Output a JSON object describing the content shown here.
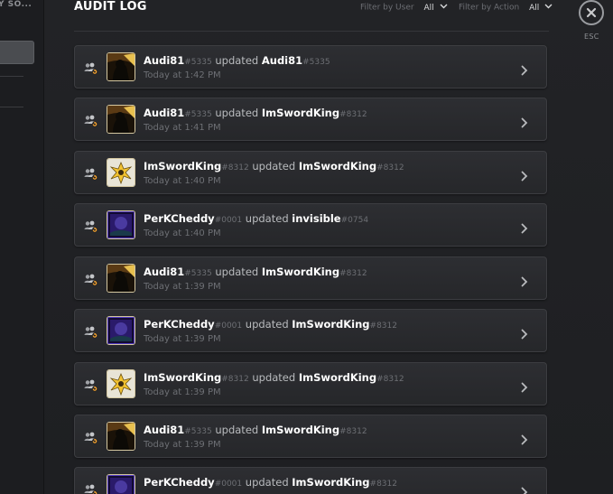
{
  "sidebar": {
    "heading": "Y SO..."
  },
  "header": {
    "title": "AUDIT LOG"
  },
  "filters": {
    "user": {
      "label": "Filter by User",
      "value": "All"
    },
    "action": {
      "label": "Filter by Action",
      "value": "All"
    }
  },
  "close": {
    "label": "ESC"
  },
  "entries": [
    {
      "actor": "Audi81",
      "actor_disc": "#5335",
      "verb": " updated ",
      "target": "Audi81",
      "target_disc": "#5335",
      "time": "Today at 1:42 PM",
      "avatar": "audi"
    },
    {
      "actor": "Audi81",
      "actor_disc": "#5335",
      "verb": " updated ",
      "target": "ImSwordKing",
      "target_disc": "#8312",
      "time": "Today at 1:41 PM",
      "avatar": "audi"
    },
    {
      "actor": "ImSwordKing",
      "actor_disc": "#8312",
      "verb": " updated ",
      "target": "ImSwordKing",
      "target_disc": "#8312",
      "time": "Today at 1:40 PM",
      "avatar": "sword"
    },
    {
      "actor": "PerKCheddy",
      "actor_disc": "#0001",
      "verb": " updated ",
      "target": "invisible",
      "target_disc": "#0754",
      "time": "Today at 1:40 PM",
      "avatar": "cheddy"
    },
    {
      "actor": "Audi81",
      "actor_disc": "#5335",
      "verb": " updated ",
      "target": "ImSwordKing",
      "target_disc": "#8312",
      "time": "Today at 1:39 PM",
      "avatar": "audi"
    },
    {
      "actor": "PerKCheddy",
      "actor_disc": "#0001",
      "verb": " updated ",
      "target": "ImSwordKing",
      "target_disc": "#8312",
      "time": "Today at 1:39 PM",
      "avatar": "cheddy"
    },
    {
      "actor": "ImSwordKing",
      "actor_disc": "#8312",
      "verb": " updated ",
      "target": "ImSwordKing",
      "target_disc": "#8312",
      "time": "Today at 1:39 PM",
      "avatar": "sword"
    },
    {
      "actor": "Audi81",
      "actor_disc": "#5335",
      "verb": " updated ",
      "target": "ImSwordKing",
      "target_disc": "#8312",
      "time": "Today at 1:39 PM",
      "avatar": "audi"
    },
    {
      "actor": "PerKCheddy",
      "actor_disc": "#0001",
      "verb": " updated ",
      "target": "ImSwordKing",
      "target_disc": "#8312",
      "time": "",
      "avatar": "cheddy"
    }
  ],
  "icons": {
    "action": "members-update-icon",
    "row_arrow": "chevron-right-icon",
    "close": "close-x-icon",
    "filter": "chevron-down-icon"
  },
  "colors": {
    "accent_orange": "#f0a030",
    "discriminator": "#6d6f74",
    "username": "#ffffff"
  }
}
